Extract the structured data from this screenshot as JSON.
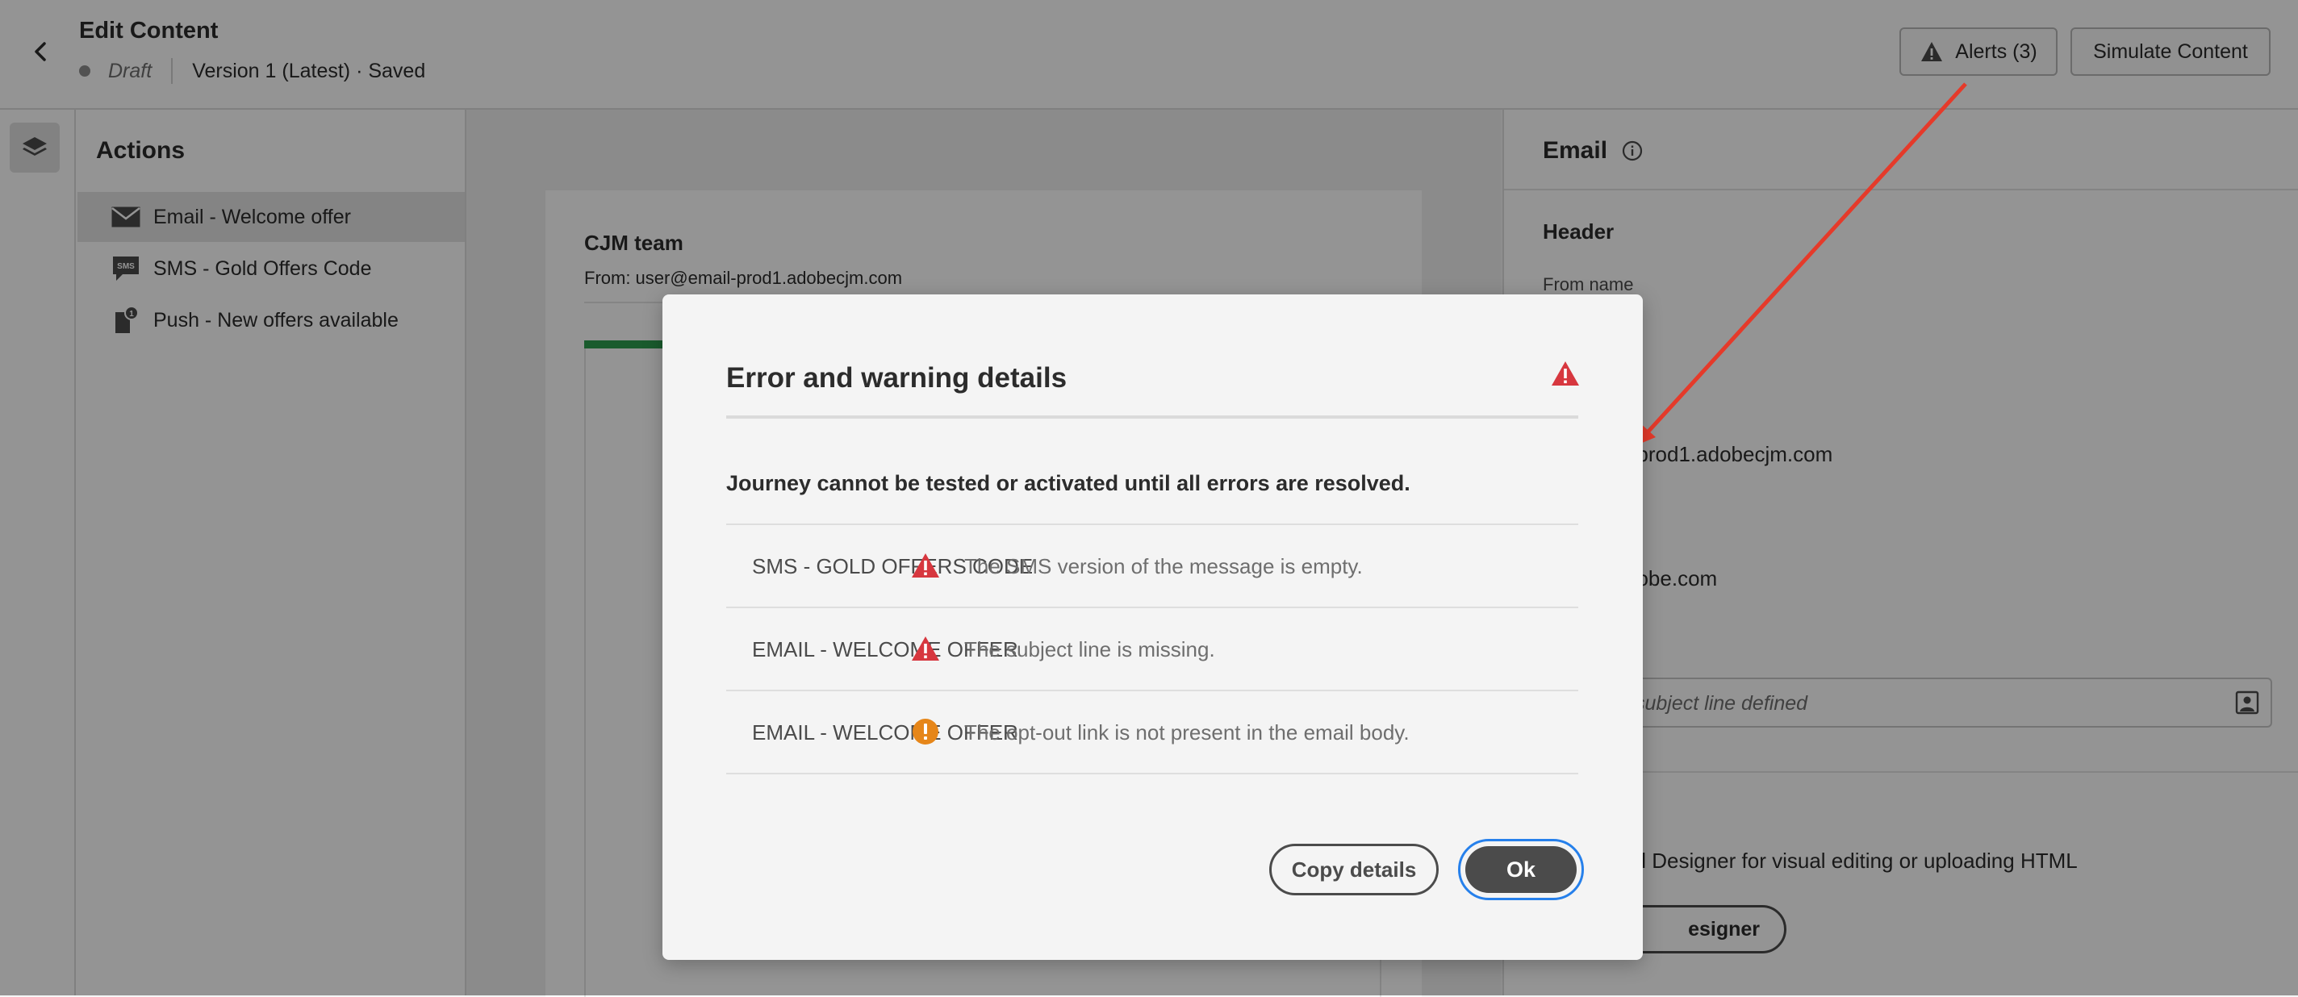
{
  "header": {
    "title": "Edit Content",
    "status": "Draft",
    "version": "Version 1 (Latest) · Saved",
    "alerts_label": "Alerts (3)",
    "simulate_label": "Simulate Content"
  },
  "actions": {
    "title": "Actions",
    "items": [
      {
        "label": "Email - Welcome offer",
        "icon": "envelope-icon"
      },
      {
        "label": "SMS - Gold Offers Code",
        "icon": "sms-icon"
      },
      {
        "label": "Push - New offers available",
        "icon": "push-notification-icon"
      }
    ]
  },
  "canvas": {
    "sender_name": "CJM team",
    "from_line": "From: user@email-prod1.adobecjm.com"
  },
  "properties": {
    "title": "Email",
    "header": "Header",
    "from_name_label": "From name",
    "visible_value_1": "l-prod1.adobecjm.com",
    "visible_value_2": "dobe.com",
    "subject_placeholder": "subject line defined",
    "designer_text": "ail Designer for visual editing or uploading HTML",
    "designer_button": "esigner"
  },
  "modal": {
    "title": "Error and warning details",
    "description": "Journey cannot be tested or activated until all errors are resolved.",
    "rows": [
      {
        "name": "SMS - GOLD OFFERS CODE",
        "severity": "error",
        "message": "The SMS version of the message is empty."
      },
      {
        "name": "EMAIL - WELCOME OFFER",
        "severity": "error",
        "message": "The subject line is missing."
      },
      {
        "name": "EMAIL - WELCOME OFFER",
        "severity": "warning",
        "message": "The opt-out link is not present in the email body."
      }
    ],
    "copy_label": "Copy details",
    "ok_label": "Ok"
  },
  "colors": {
    "error": "#d7373f",
    "warning": "#e68619",
    "focus": "#2680eb",
    "annotation_arrow": "#e53a2a",
    "progress_green": "#2d9d4e"
  }
}
